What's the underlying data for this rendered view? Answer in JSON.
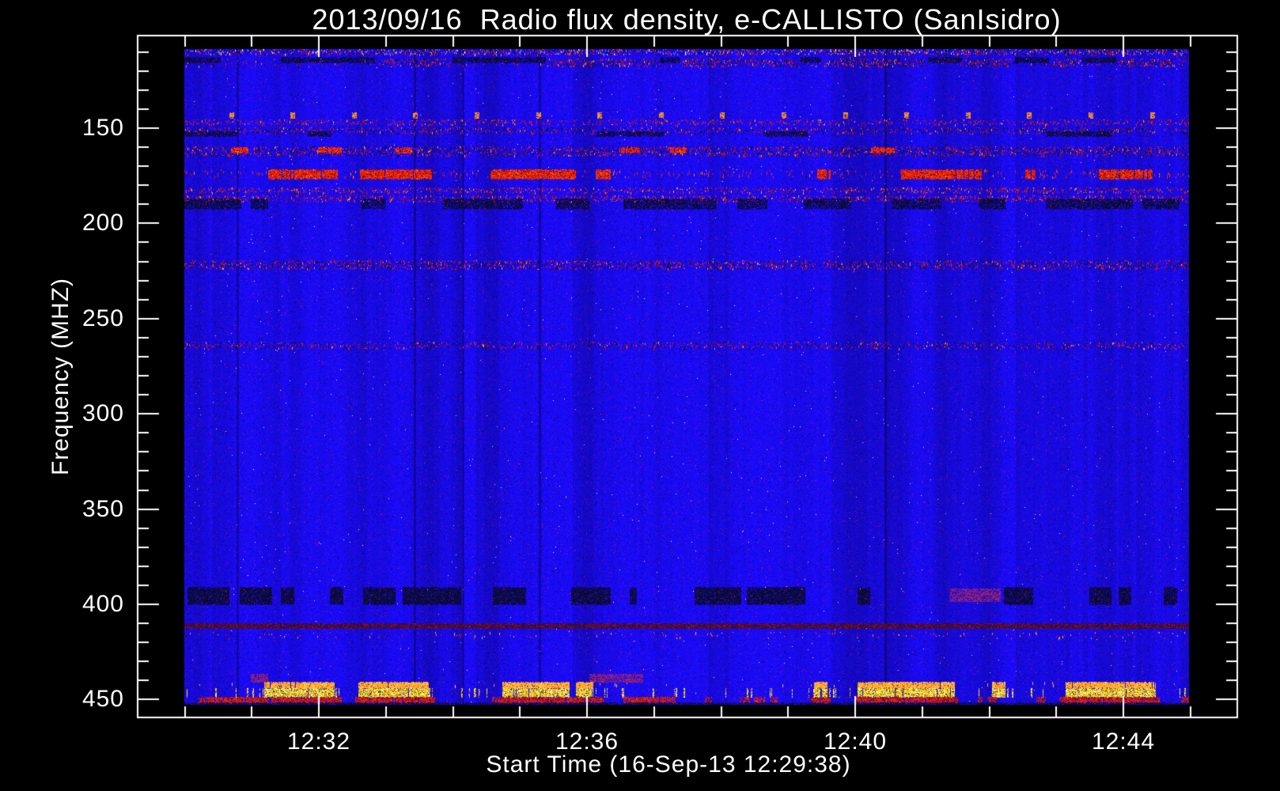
{
  "page": {
    "background": "#000000"
  },
  "chart_data": {
    "type": "heatmap",
    "title": "2013/09/16  Radio flux density, e-CALLISTO (SanIsidro)",
    "station": "SanIsidro",
    "date": "2013/09/16",
    "xlabel": "Start Time (16-Sep-13 12:29:38)",
    "ylabel": "Frequency (MHZ)",
    "start_time": "12:29:38",
    "x_axis": {
      "major_ticks": [
        {
          "label": "12:32",
          "min": 2.367
        },
        {
          "label": "12:36",
          "min": 6.367
        },
        {
          "label": "12:40",
          "min": 10.367
        },
        {
          "label": "12:44",
          "min": 14.367
        }
      ],
      "minor_first_min": 0.367,
      "minor_step_min": 1,
      "minor_last_min": 15.367,
      "duration_min": 15.4
    },
    "y_axis": {
      "unit": "MHZ",
      "major_ticks": [
        150,
        200,
        250,
        300,
        350,
        400,
        450
      ],
      "minor_step_mhz": 10,
      "minor_min_mhz": 110,
      "displayed_range_mhz": [
        108,
        453
      ],
      "increasing_downward": true
    },
    "background": {
      "base_color": "#1a15e6",
      "dark_time_columns_min": [
        1.15,
        3.8,
        4.52,
        5.66,
        10.82
      ]
    },
    "colors": {
      "frame": "#ffffff",
      "text": "#ffffff",
      "quiet": "#1a15e6",
      "rfi_red": "#dd1100",
      "rfi_orange": "#ff8c1a",
      "rfi_yellow": "#ffe020",
      "interference_dark": "#000030"
    },
    "features": [
      {
        "id": "speckle-108",
        "freq_mhz": [
          108,
          111
        ],
        "style": "speckle",
        "density": 0.8,
        "palette": "mixed"
      },
      {
        "id": "speckle-115",
        "freq_mhz": [
          113.5,
          117
        ],
        "style": "speckle",
        "density": 0.75,
        "palette": "redDark",
        "segments_min": [
          [
            3.3,
            4.3
          ],
          [
            5.8,
            7.4
          ],
          [
            7.8,
            9.5
          ],
          [
            9.9,
            11.4
          ],
          [
            12.0,
            12.7
          ],
          [
            13.3,
            13.7
          ],
          [
            14.3,
            15.1
          ]
        ]
      },
      {
        "id": "dark-113",
        "freq_mhz": [
          112.5,
          115.5
        ],
        "style": "dark-segments",
        "segments_min": [
          [
            0,
            0.9
          ],
          [
            1.8,
            3.2
          ],
          [
            4.35,
            5.75
          ],
          [
            7.45,
            7.75
          ],
          [
            9.55,
            9.85
          ],
          [
            11.45,
            11.95
          ],
          [
            12.75,
            13.25
          ],
          [
            13.75,
            14.25
          ]
        ]
      },
      {
        "id": "minute-dots-142",
        "freq_mhz": [
          141.5,
          144.5
        ],
        "style": "dots",
        "period_min": 0.9156,
        "phase_min": 1.03,
        "color": "#ff8c1a"
      },
      {
        "id": "speckle-147",
        "freq_mhz": [
          145.5,
          148
        ],
        "style": "speckle",
        "density": 0.4,
        "palette": "red"
      },
      {
        "id": "speckle-151",
        "freq_mhz": [
          149.5,
          152.5
        ],
        "style": "speckle",
        "density": 0.55,
        "palette": "redDark"
      },
      {
        "id": "dark-152",
        "freq_mhz": [
          151.5,
          154
        ],
        "style": "dark-segments",
        "segments_min": [
          [
            0,
            1.15
          ],
          [
            2.2,
            2.55
          ],
          [
            6.5,
            7.5
          ],
          [
            9.0,
            9.65
          ],
          [
            13.2,
            14.2
          ]
        ]
      },
      {
        "id": "speckle-162",
        "freq_mhz": [
          159.5,
          164
        ],
        "style": "speckle",
        "density": 0.6,
        "palette": "redDark"
      },
      {
        "id": "patches-162",
        "freq_mhz": [
          160,
          163
        ],
        "style": "bursts",
        "color_mode": "red",
        "density_outside": 0,
        "segments_min": [
          [
            1.05,
            1.3
          ],
          [
            2.35,
            2.7
          ],
          [
            3.5,
            3.75
          ],
          [
            6.85,
            7.15
          ],
          [
            7.6,
            7.85
          ],
          [
            10.6,
            10.95
          ]
        ]
      },
      {
        "id": "burst-174",
        "freq_mhz": [
          171.5,
          176.5
        ],
        "style": "bursts",
        "color_mode": "red",
        "density_outside": 0.25,
        "segments_min": [
          [
            1.6,
            2.65
          ],
          [
            2.98,
            4.05
          ],
          [
            4.92,
            6.2
          ],
          [
            6.48,
            6.72
          ],
          [
            9.8,
            10.0
          ],
          [
            11.05,
            12.25
          ],
          [
            12.9,
            13.05
          ],
          [
            14.0,
            14.8
          ]
        ]
      },
      {
        "id": "speckle-183",
        "freq_mhz": [
          181,
          183.5
        ],
        "style": "speckle",
        "density": 0.45,
        "palette": "red"
      },
      {
        "id": "speckle-188",
        "freq_mhz": [
          185.5,
          188
        ],
        "style": "speckle",
        "density": 0.5,
        "palette": "red"
      },
      {
        "id": "dark-190",
        "freq_mhz": [
          187,
          192.5
        ],
        "style": "dark-segments",
        "segments_min": [
          [
            0,
            1.2
          ],
          [
            1.35,
            1.6
          ],
          [
            3.0,
            3.35
          ],
          [
            4.2,
            5.4
          ],
          [
            5.9,
            6.4
          ],
          [
            6.9,
            8.3
          ],
          [
            8.6,
            9.05
          ],
          [
            9.6,
            10.3
          ],
          [
            10.9,
            11.65
          ],
          [
            12.2,
            12.6
          ],
          [
            13.2,
            14.5
          ],
          [
            14.65,
            15.2
          ]
        ]
      },
      {
        "id": "speckle-221",
        "freq_mhz": [
          219.5,
          223.5
        ],
        "style": "speckle",
        "density": 0.65,
        "palette": "redDark"
      },
      {
        "id": "speckle-264",
        "freq_mhz": [
          262,
          265.5
        ],
        "style": "speckle",
        "density": 0.4,
        "palette": "redDark"
      },
      {
        "id": "dark-396",
        "freq_mhz": [
          391,
          400
        ],
        "style": "dark-blocks",
        "segments_min": [
          [
            0.4,
            1.03
          ],
          [
            1.18,
            1.66
          ],
          [
            1.8,
            2.0
          ],
          [
            2.53,
            2.73
          ],
          [
            3.02,
            3.51
          ],
          [
            3.61,
            4.48
          ],
          [
            4.96,
            5.45
          ],
          [
            6.12,
            6.71
          ],
          [
            7.0,
            7.1
          ],
          [
            7.97,
            8.66
          ],
          [
            8.75,
            9.62
          ],
          [
            10.4,
            10.59
          ],
          [
            12.58,
            13.02
          ],
          [
            13.85,
            14.18
          ],
          [
            14.29,
            14.48
          ],
          [
            14.96,
            15.16
          ]
        ]
      },
      {
        "id": "purple-396",
        "freq_mhz": [
          391.5,
          398.5
        ],
        "style": "purple-patch",
        "segments_min": [
          [
            11.76,
            12.53
          ]
        ]
      },
      {
        "id": "line-411",
        "freq_mhz": [
          410,
          412.5
        ],
        "style": "dark-red-line"
      },
      {
        "id": "dots-416",
        "freq_mhz": [
          414.5,
          417.5
        ],
        "style": "speckle",
        "density": 0.08,
        "palette": "redOrange"
      },
      {
        "id": "smudge-439",
        "freq_mhz": [
          436.5,
          440.5
        ],
        "style": "purple-patch",
        "segments_min": [
          [
            1.35,
            1.6
          ],
          [
            6.4,
            7.2
          ]
        ]
      },
      {
        "id": "burst-443-orange",
        "freq_mhz": [
          440.5,
          444
        ],
        "style": "bursts",
        "color_mode": "orange",
        "density_outside": 0.02,
        "segments_min": [
          [
            1.55,
            2.6
          ],
          [
            2.95,
            4.0
          ],
          [
            5.1,
            6.1
          ],
          [
            6.2,
            6.45
          ],
          [
            9.75,
            9.95
          ],
          [
            10.4,
            11.85
          ],
          [
            12.4,
            12.6
          ],
          [
            13.5,
            14.85
          ]
        ]
      },
      {
        "id": "burst-447-yellow",
        "freq_mhz": [
          444,
          448.5
        ],
        "style": "bursts",
        "color_mode": "yellow",
        "density_outside": 0.07,
        "segments_min": [
          [
            1.55,
            2.6
          ],
          [
            2.95,
            4.0
          ],
          [
            5.1,
            6.1
          ],
          [
            6.2,
            6.45
          ],
          [
            9.75,
            9.95
          ],
          [
            10.4,
            11.85
          ],
          [
            12.4,
            12.6
          ],
          [
            13.5,
            14.85
          ]
        ]
      },
      {
        "id": "burst-451-red",
        "freq_mhz": [
          448.5,
          451.5
        ],
        "style": "bursts",
        "color_mode": "darkred",
        "density_outside": 0.12,
        "segments_min": [
          [
            0.6,
            1.6
          ],
          [
            1.65,
            2.7
          ],
          [
            2.9,
            4.1
          ],
          [
            5.0,
            6.5
          ],
          [
            6.9,
            7.6
          ],
          [
            9.7,
            10.0
          ],
          [
            10.35,
            11.9
          ],
          [
            13.4,
            14.9
          ]
        ]
      },
      {
        "id": "edge-452",
        "freq_mhz": [
          451.5,
          453
        ],
        "style": "dark-segments",
        "segments_min": [
          [
            0,
            15.4
          ]
        ]
      }
    ]
  }
}
